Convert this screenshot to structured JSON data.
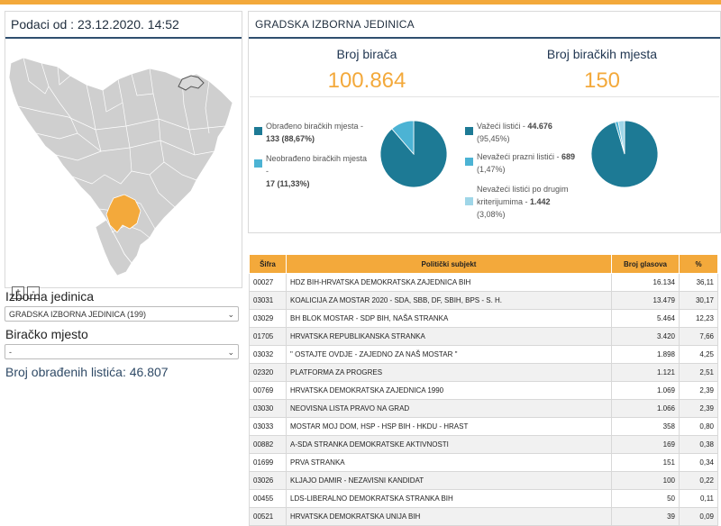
{
  "map_panel": {
    "date_label": "Podaci od : 23.12.2020. 14:52",
    "zoom_in": "+",
    "zoom_out": "-",
    "highlight_color": "#f3a93b"
  },
  "filters": {
    "unit_label": "Izborna jedinica",
    "unit_value": "GRADSKA IZBORNA JEDINICA (199)",
    "place_label": "Biračko mjesto",
    "place_value": "-",
    "processed_label": "Broj obrađenih listića: 46.807"
  },
  "summary": {
    "header": "GRADSKA IZBORNA JEDINICA",
    "voters_title": "Broj birača",
    "voters_value": "100.864",
    "stations_title": "Broj biračkih mjesta",
    "stations_value": "150",
    "pie1": {
      "processed_label": "Obrađeno biračkih mjesta -",
      "processed_value": "133 (88,67%)",
      "processed_fraction": 0.8867,
      "unprocessed_label": "Neobrađeno biračkih mjesta -",
      "unprocessed_value": "17 (11,33%)"
    },
    "pie2": {
      "valid_label": "Važeći listići -",
      "valid_value": "44.676",
      "valid_pct": "(95,45%)",
      "valid_fraction": 0.9545,
      "empty_label": "Nevažeći prazni listići -",
      "empty_value": "689",
      "empty_pct": "(1,47%)",
      "empty_fraction": 0.0147,
      "other_label_1": "Nevažeći listići po drugim",
      "other_label_2": "kriterijumima -",
      "other_value": "1.442",
      "other_pct": "(3,08%)"
    },
    "colors": {
      "dark": "#1d7a95",
      "mid": "#4cb3d4",
      "light": "#9fd6e8"
    }
  },
  "table": {
    "headers": [
      "Šifra",
      "Politički subjekt",
      "Broj glasova",
      "%"
    ],
    "rows": [
      [
        "00027",
        "HDZ BIH-HRVATSKA DEMOKRATSKA ZAJEDNICA BIH",
        "16.134",
        "36,11"
      ],
      [
        "03031",
        "KOALICIJA ZA MOSTAR 2020 - SDA, SBB, DF, SBIH, BPS - S. H.",
        "13.479",
        "30,17"
      ],
      [
        "03029",
        "BH BLOK MOSTAR - SDP BIH, NAŠA STRANKA",
        "5.464",
        "12,23"
      ],
      [
        "01705",
        "HRVATSKA REPUBLIKANSKA STRANKA",
        "3.420",
        "7,66"
      ],
      [
        "03032",
        "\" OSTAJTE OVDJE - ZAJEDNO ZA NAŠ MOSTAR \"",
        "1.898",
        "4,25"
      ],
      [
        "02320",
        "PLATFORMA ZA PROGRES",
        "1.121",
        "2,51"
      ],
      [
        "00769",
        "HRVATSKA DEMOKRATSKA ZAJEDNICA 1990",
        "1.069",
        "2,39"
      ],
      [
        "03030",
        "NEOVISNA LISTA PRAVO NA GRAD",
        "1.066",
        "2,39"
      ],
      [
        "03033",
        "MOSTAR MOJ DOM, HSP - HSP BIH - HKDU - HRAST",
        "358",
        "0,80"
      ],
      [
        "00882",
        "A-SDA STRANKA DEMOKRATSKE AKTIVNOSTI",
        "169",
        "0,38"
      ],
      [
        "01699",
        "PRVA STRANKA",
        "151",
        "0,34"
      ],
      [
        "03026",
        "KLJAJO DAMIR - NEZAVISNI KANDIDAT",
        "100",
        "0,22"
      ],
      [
        "00455",
        "LDS-LIBERALNO DEMOKRATSKA STRANKA BIH",
        "50",
        "0,11"
      ],
      [
        "00521",
        "HRVATSKA DEMOKRATSKA UNIJA BIH",
        "39",
        "0,09"
      ]
    ]
  }
}
